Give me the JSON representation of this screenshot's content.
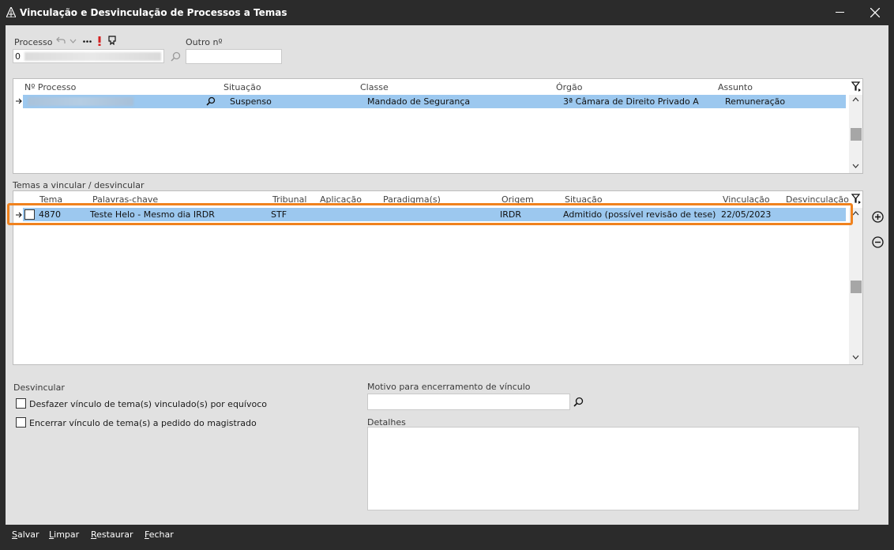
{
  "window": {
    "title": "Vinculação e Desvinculação de Processos a Temas"
  },
  "processo": {
    "label": "Processo",
    "value_prefix": "0",
    "outro_label": "Outro nº",
    "outro_value": ""
  },
  "processos_grid": {
    "columns": [
      "Nº Processo",
      "Situação",
      "Classe",
      "Órgão",
      "Assunto"
    ],
    "rows": [
      {
        "numero": "",
        "situacao": "Suspenso",
        "classe": "Mandado de Segurança",
        "orgao": "3ª Câmara de Direito Privado A",
        "assunto": "Remuneração"
      }
    ]
  },
  "temas_grid": {
    "section_label": "Temas a vincular / desvincular",
    "columns": [
      "Tema",
      "Palavras-chave",
      "Tribunal",
      "Aplicação",
      "Paradigma(s)",
      "Origem",
      "Situação",
      "Vinculação",
      "Desvinculação"
    ],
    "rows": [
      {
        "tema": "4870",
        "palavras": "Teste Helo - Mesmo dia IRDR",
        "tribunal": "STF",
        "aplicacao": "",
        "paradigma": "",
        "origem": "IRDR",
        "situacao": "Admitido (possível revisão de tese)",
        "vinculacao": "22/05/2023",
        "desvinculacao": "",
        "checked": false
      }
    ]
  },
  "desvincular": {
    "label": "Desvincular",
    "option1": "Desfazer vínculo de tema(s) vinculado(s) por equívoco",
    "option2": "Encerrar vínculo de tema(s) a pedido do magistrado",
    "option1_checked": false,
    "option2_checked": false
  },
  "motivo": {
    "label": "Motivo para encerramento de vínculo",
    "value": ""
  },
  "detalhes": {
    "label": "Detalhes",
    "value": ""
  },
  "footer": {
    "salvar": {
      "accel": "S",
      "rest": "alvar"
    },
    "limpar": {
      "accel": "L",
      "rest": "impar"
    },
    "restaurar": {
      "accel": "R",
      "rest": "estaurar"
    },
    "fechar": {
      "accel": "F",
      "rest": "echar"
    }
  },
  "colors": {
    "selection": "#9cc8ef",
    "highlight": "#f0821e",
    "chrome": "#2b2b2b",
    "panel": "#e1e1e1"
  }
}
